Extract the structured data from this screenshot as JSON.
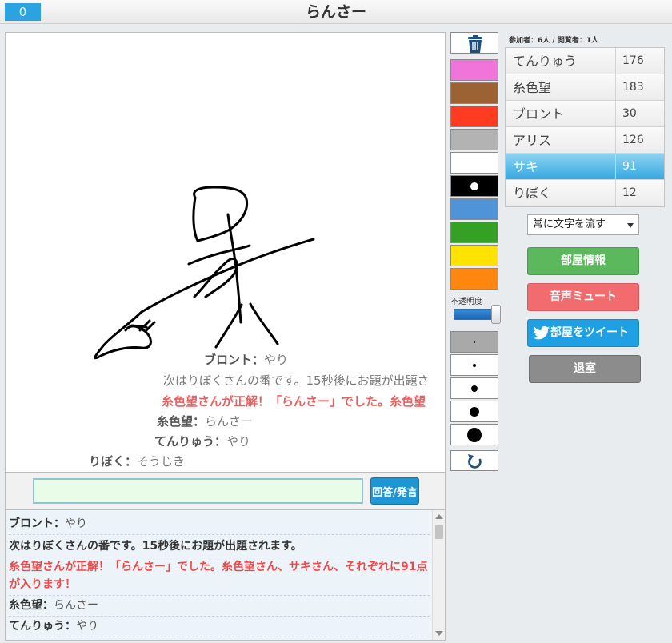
{
  "header": {
    "counter": "0",
    "title": "らんさー"
  },
  "canvas_messages": [
    {
      "name": "ブロント",
      "sep": "：",
      "text": "やり",
      "type": "normal"
    },
    {
      "name": "",
      "sep": "",
      "text": "次はりぼくさんの番です。15秒後にお題が出題さ",
      "type": "system"
    },
    {
      "name": "",
      "sep": "",
      "text": "糸色望さんが正解！「らんさー」でした。糸色望",
      "type": "correct"
    },
    {
      "name": "糸色望",
      "sep": "：",
      "text": "らんさー",
      "type": "normal"
    },
    {
      "name": "てんりゅう",
      "sep": "：",
      "text": "やり",
      "type": "normal"
    },
    {
      "name": "りぼく",
      "sep": "：",
      "text": "そうじき",
      "type": "normal"
    }
  ],
  "answer": {
    "value": "",
    "button_label": "回答/発言"
  },
  "chat_log": [
    {
      "name": "ブロント",
      "sep": "：",
      "text": "やり"
    },
    {
      "text": "次はりぼくさんの番です。15秒後にお題が出題されます。"
    },
    {
      "text": "糸色望さんが正解！「らんさー」でした。糸色望さん、サキさん、それぞれに91点が入ります！"
    },
    {
      "name": "糸色望",
      "sep": "：",
      "text": "らんさー"
    },
    {
      "name": "てんりゅう",
      "sep": "：",
      "text": "やり"
    }
  ],
  "tools": {
    "colors": [
      "#f074d9",
      "#9c6234",
      "#ff3b22",
      "#b3b3b3",
      "#ffffff",
      "#000000",
      "#4f93d8",
      "#34a125",
      "#ffe300",
      "#ff870f"
    ],
    "opacity_label": "不透明度",
    "opacity_value": 1.0,
    "brush_sizes": [
      2,
      4,
      8,
      12,
      18
    ],
    "selected_brush": 0,
    "selected_color": 5,
    "icons": [
      "trash-icon",
      "undo-icon"
    ]
  },
  "players_info": {
    "label": "参加者：6人 / 閲覧者：1人"
  },
  "players": [
    {
      "name": "てんりゅう",
      "score": "176",
      "active": false
    },
    {
      "name": "糸色望",
      "score": "183",
      "active": false
    },
    {
      "name": "ブロント",
      "score": "30",
      "active": false
    },
    {
      "name": "アリス",
      "score": "126",
      "active": false
    },
    {
      "name": "サキ",
      "score": "91",
      "active": true
    },
    {
      "name": "りぼく",
      "score": "12",
      "active": false
    }
  ],
  "scroll_mode": {
    "selected": "常に文字を流す"
  },
  "buttons": {
    "room_info": "部屋情報",
    "mute": "音声ミュート",
    "tweet": "部屋をツイート",
    "leave": "退室"
  }
}
